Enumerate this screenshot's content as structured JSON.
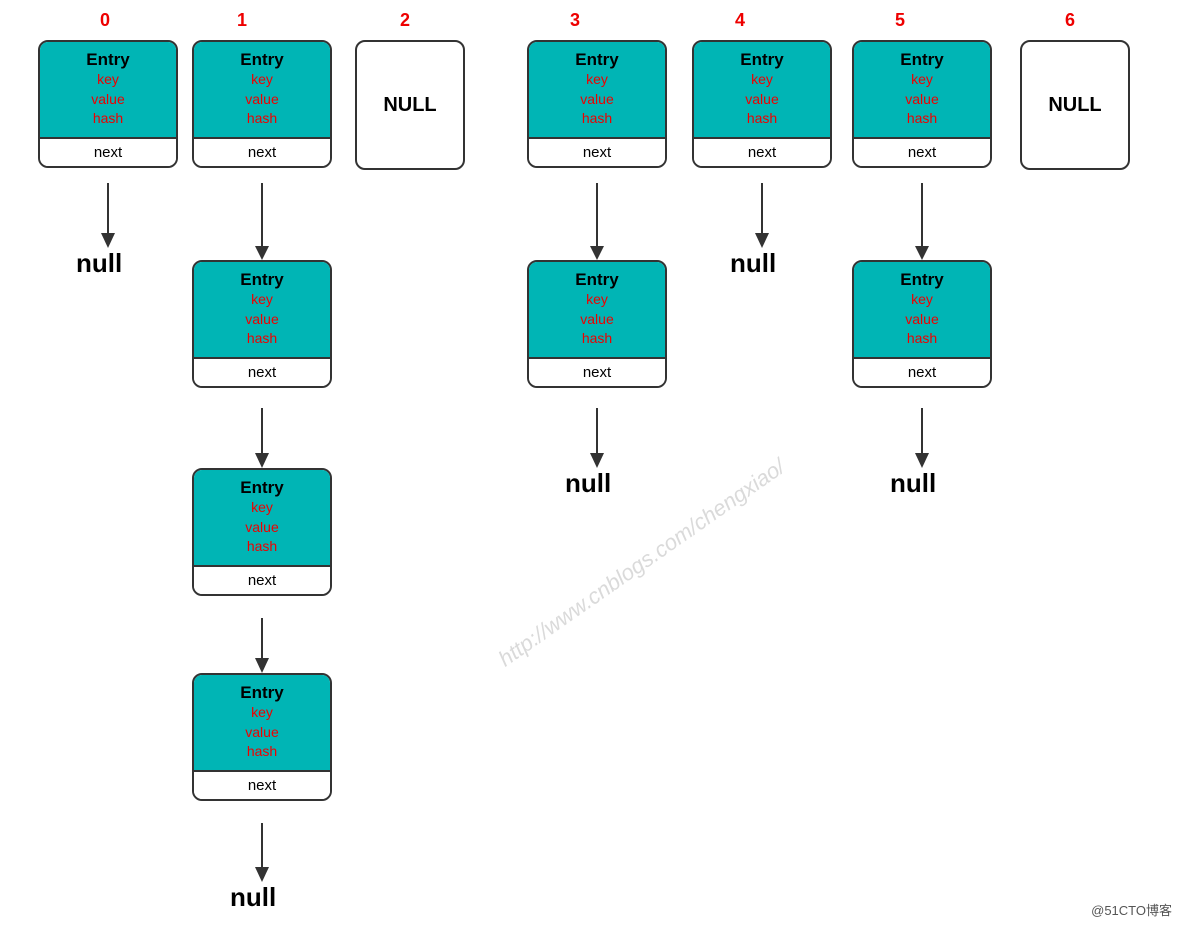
{
  "indices": [
    "0",
    "1",
    "2",
    "3",
    "4",
    "5",
    "6"
  ],
  "index_color": "#dd0000",
  "entry_title": "Entry",
  "entry_fields": [
    "key",
    "value",
    "hash"
  ],
  "next_label": "next",
  "null_label": "NULL",
  "null_lower": "null",
  "watermark": "http://www.cnblogs.com/chengxiao/",
  "credit": "@51CTO博客",
  "colors": {
    "teal": "#00b5b5",
    "border": "#333333",
    "red_field": "#ee0000",
    "white": "#ffffff"
  }
}
